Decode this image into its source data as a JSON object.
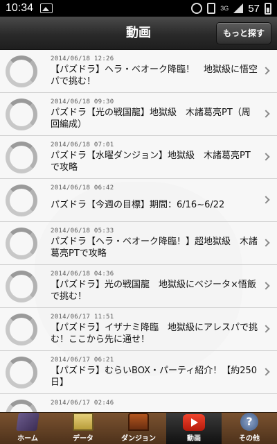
{
  "status_bar": {
    "time": "10:34",
    "network": "3G",
    "battery": "57"
  },
  "header": {
    "title": "動画",
    "more_button": "もっと探す"
  },
  "videos": [
    {
      "date": "2014/06/18 12:26",
      "title": "【パズドラ】ヘラ・ベオーク降臨！　地獄級に悟空パで挑む！"
    },
    {
      "date": "2014/06/18 09:30",
      "title": "パズドラ【光の戦国龍】地獄級　木諸葛亮PT（周回編成）"
    },
    {
      "date": "2014/06/18 07:01",
      "title": "パズドラ【水曜ダンジョン】地獄級　木諸葛亮PTで攻略"
    },
    {
      "date": "2014/06/18 06:42",
      "title": "パズドラ【今週の目標】期間：6/16~6/22"
    },
    {
      "date": "2014/06/18 05:33",
      "title": "パズドラ【ヘラ・ベオーク降臨！】超地獄級　木諸葛亮PTで攻略"
    },
    {
      "date": "2014/06/18 04:36",
      "title": "【パズドラ】光の戦国龍　地獄級にベジータ×悟飯で挑む！"
    },
    {
      "date": "2014/06/17 11:51",
      "title": "【パズドラ】イザナミ降臨　地獄級にアレスパで挑む！ここから先に通せ！"
    },
    {
      "date": "2014/06/17 06:21",
      "title": "【パズドラ】むらいBOX・パーティ紹介！【約250日】"
    },
    {
      "date": "2014/06/17 02:46",
      "title": ""
    }
  ],
  "tabs": [
    {
      "label": "ホーム",
      "icon": "home-icon"
    },
    {
      "label": "データ",
      "icon": "data-icon"
    },
    {
      "label": "ダンジョン",
      "icon": "dungeon-icon"
    },
    {
      "label": "動画",
      "icon": "video-icon",
      "active": true
    },
    {
      "label": "その他",
      "icon": "other-icon"
    }
  ],
  "colors": {
    "header_bg": "#2a2a2a",
    "tabbar_bg": "#6a4525",
    "video_red": "#e03a22"
  }
}
